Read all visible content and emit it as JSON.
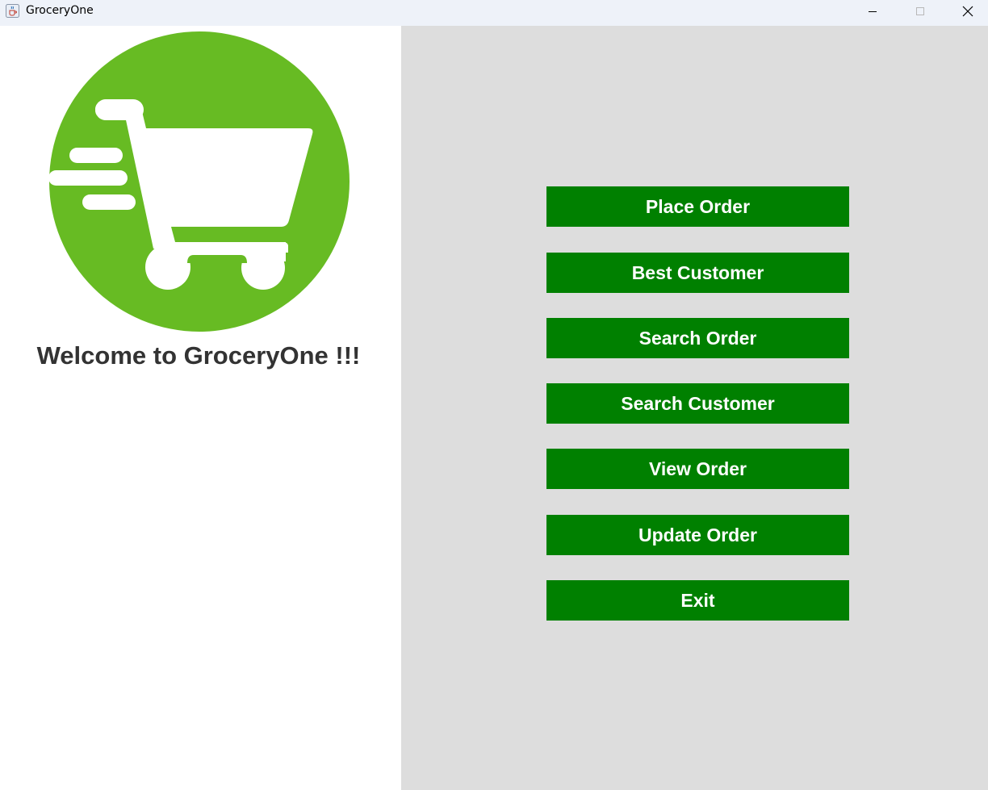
{
  "window": {
    "title": "GroceryOne",
    "icon": "java-cup-icon",
    "controls": [
      "minimize-icon",
      "maximize-icon",
      "close-icon"
    ]
  },
  "left_panel": {
    "logo": "shopping-cart-icon",
    "welcome_text": "Welcome to GroceryOne !!!"
  },
  "menu": {
    "buttons": [
      {
        "label": "Place Order"
      },
      {
        "label": "Best Customer"
      },
      {
        "label": "Search Order"
      },
      {
        "label": "Search Customer"
      },
      {
        "label": "View Order"
      },
      {
        "label": "Update Order"
      },
      {
        "label": "Exit"
      }
    ]
  },
  "colors": {
    "button_bg": "#008000",
    "button_text": "#ffffff",
    "logo_green": "#67bb23",
    "right_panel_bg": "#dddddd",
    "welcome_text": "#333333"
  }
}
